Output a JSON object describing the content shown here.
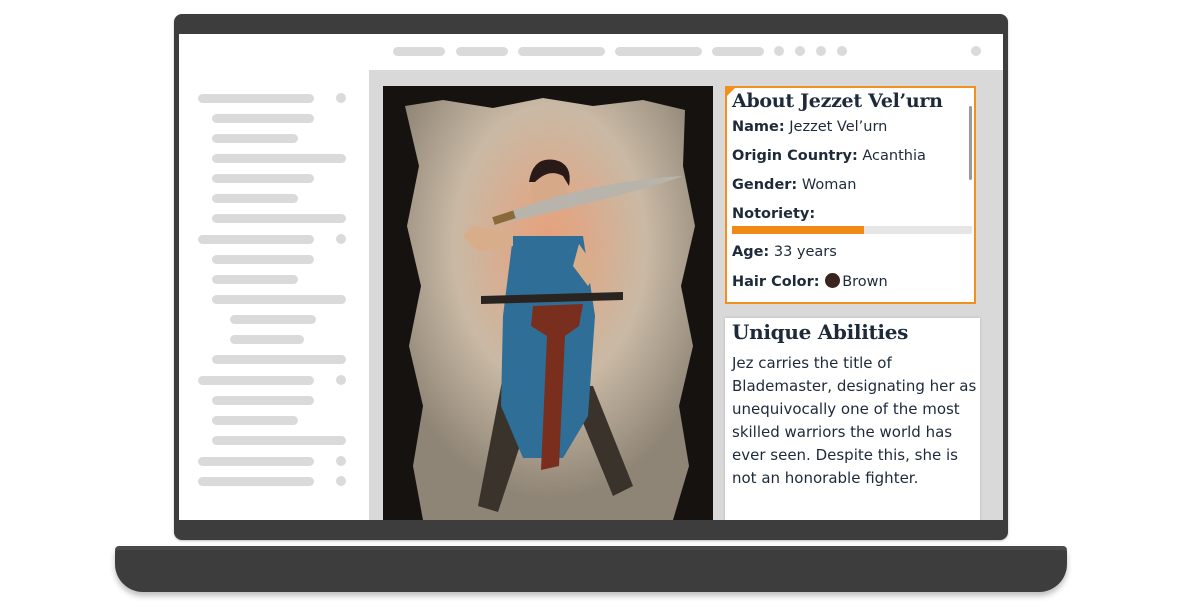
{
  "about": {
    "title": "About Jezzet Vel’urn",
    "name_label": "Name:",
    "name_value": "Jezzet Vel’urn",
    "origin_label": "Origin Country:",
    "origin_value": "Acanthia",
    "gender_label": "Gender:",
    "gender_value": "Woman",
    "notoriety_label": "Notoriety:",
    "notoriety_fraction": 0.55,
    "age_label": "Age:",
    "age_value": "33 years",
    "hair_label": "Hair Color:",
    "hair_value": "Brown",
    "hair_swatch_color": "#3a2420"
  },
  "abilities": {
    "title": "Unique Abilities",
    "text": "Jez carries the title of Blademaster, designating her as unequivocally one of the most skilled warriors the world has ever seen. Despite this, she is not an honorable fighter."
  },
  "colors": {
    "accent": "#f0901e",
    "frame": "#3d3d3d",
    "placeholder": "#dadada"
  }
}
